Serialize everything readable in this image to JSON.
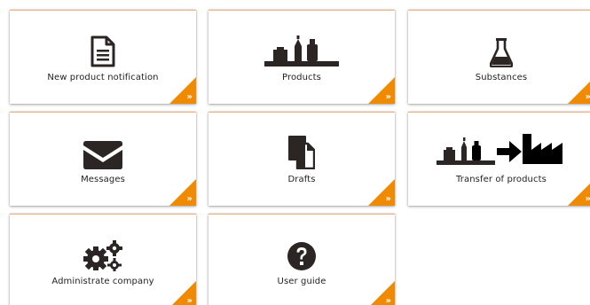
{
  "tiles": [
    {
      "label": "New product notification",
      "icon": "document-icon"
    },
    {
      "label": "Products",
      "icon": "products-icon"
    },
    {
      "label": "Substances",
      "icon": "flask-icon"
    },
    {
      "label": "Messages",
      "icon": "envelope-icon"
    },
    {
      "label": "Drafts",
      "icon": "drafts-icon"
    },
    {
      "label": "Transfer of products",
      "icon": "transfer-products-icon"
    },
    {
      "label": "Administrate company",
      "icon": "gears-icon"
    },
    {
      "label": "User guide",
      "icon": "question-circle-icon"
    }
  ],
  "corner_glyph": "»",
  "colors": {
    "accent": "#f08a00",
    "icon": "#2b2523",
    "text": "#1f1f1f"
  }
}
